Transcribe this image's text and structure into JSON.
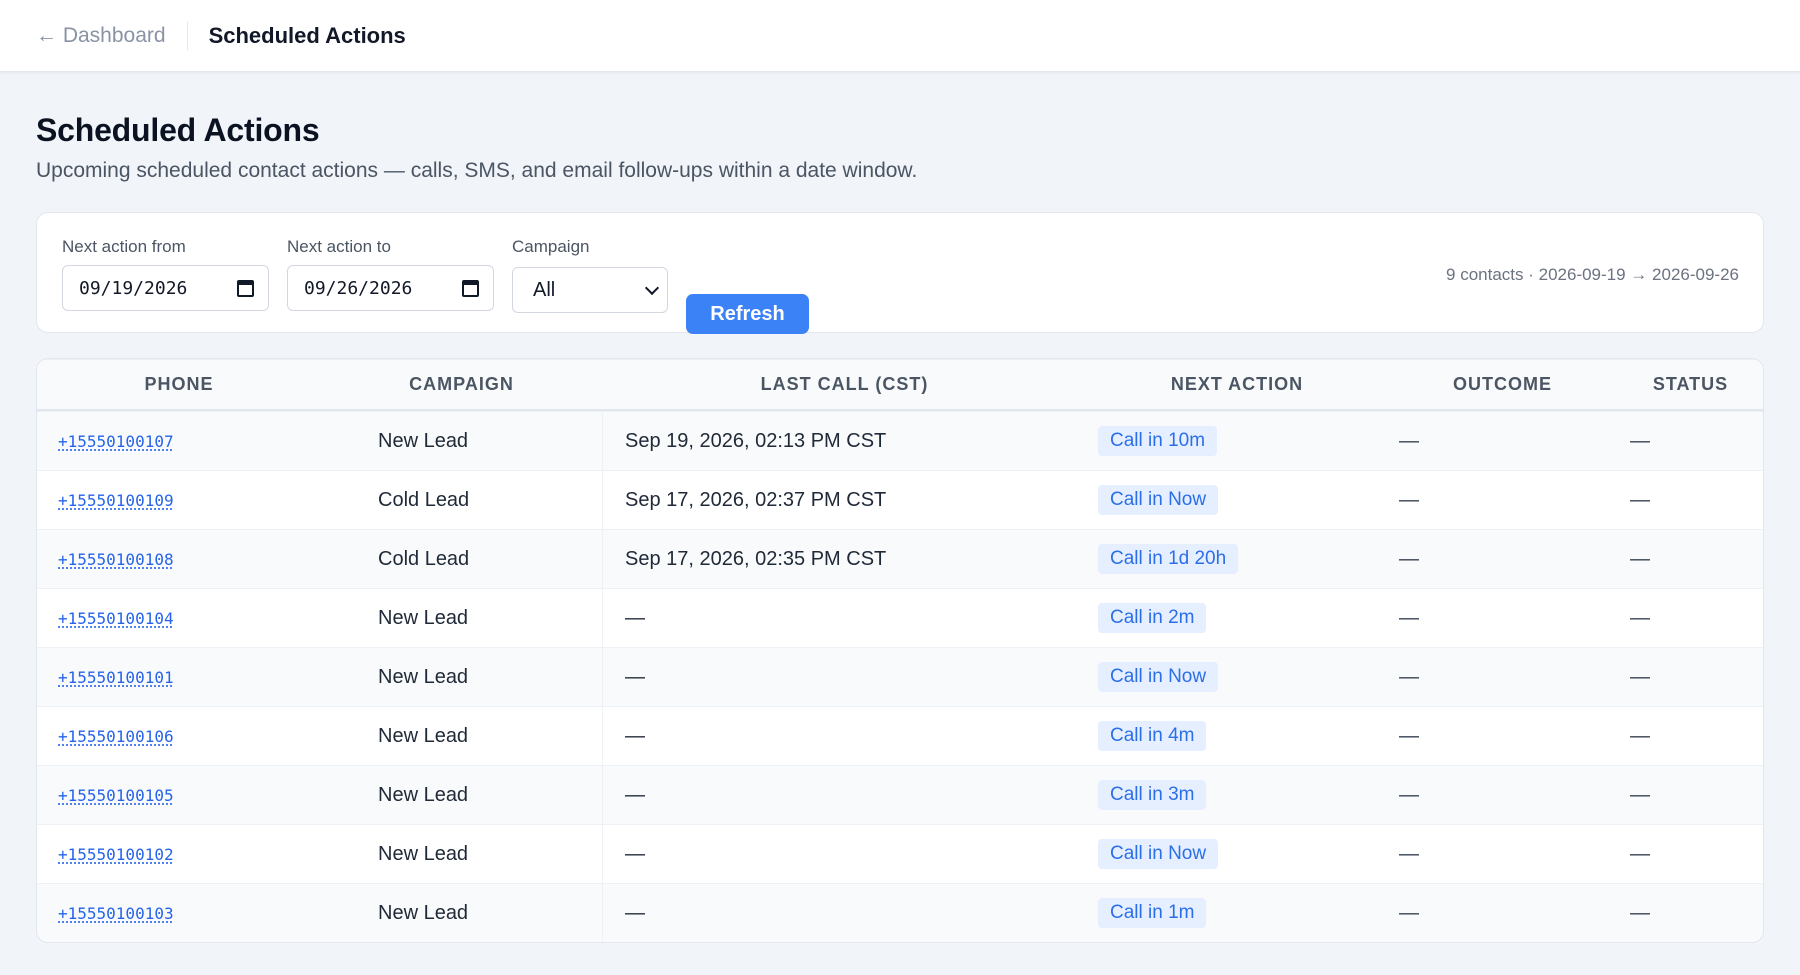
{
  "topbar": {
    "back_label": "← Dashboard",
    "title": "Scheduled Actions"
  },
  "page": {
    "title": "Scheduled Actions",
    "subtitle": "Upcoming scheduled contact actions — calls, SMS, and email follow-ups within a date window."
  },
  "filters": {
    "from_label": "Next action from",
    "from_value": "09/19/2026",
    "to_label": "Next action to",
    "to_value": "09/26/2026",
    "campaign_label": "Campaign",
    "campaign_value": "All",
    "refresh_label": "Refresh",
    "summary": "9 contacts · 2026-09-19 → 2026-09-26"
  },
  "table": {
    "columns": [
      "PHONE",
      "CAMPAIGN",
      "LAST CALL (CST)",
      "NEXT ACTION",
      "OUTCOME",
      "STATUS"
    ],
    "rows": [
      {
        "phone": "+15550100107",
        "campaign": "New Lead",
        "last_call": "Sep 19, 2026, 02:13 PM CST",
        "next_action": "Call in 10m",
        "outcome": "—",
        "status": "—"
      },
      {
        "phone": "+15550100109",
        "campaign": "Cold Lead",
        "last_call": "Sep 17, 2026, 02:37 PM CST",
        "next_action": "Call in Now",
        "outcome": "—",
        "status": "—"
      },
      {
        "phone": "+15550100108",
        "campaign": "Cold Lead",
        "last_call": "Sep 17, 2026, 02:35 PM CST",
        "next_action": "Call in 1d 20h",
        "outcome": "—",
        "status": "—"
      },
      {
        "phone": "+15550100104",
        "campaign": "New Lead",
        "last_call": "—",
        "next_action": "Call in 2m",
        "outcome": "—",
        "status": "—"
      },
      {
        "phone": "+15550100101",
        "campaign": "New Lead",
        "last_call": "—",
        "next_action": "Call in Now",
        "outcome": "—",
        "status": "—"
      },
      {
        "phone": "+15550100106",
        "campaign": "New Lead",
        "last_call": "—",
        "next_action": "Call in 4m",
        "outcome": "—",
        "status": "—"
      },
      {
        "phone": "+15550100105",
        "campaign": "New Lead",
        "last_call": "—",
        "next_action": "Call in 3m",
        "outcome": "—",
        "status": "—"
      },
      {
        "phone": "+15550100102",
        "campaign": "New Lead",
        "last_call": "—",
        "next_action": "Call in Now",
        "outcome": "—",
        "status": "—"
      },
      {
        "phone": "+15550100103",
        "campaign": "New Lead",
        "last_call": "—",
        "next_action": "Call in 1m",
        "outcome": "—",
        "status": "—"
      }
    ]
  },
  "colors": {
    "accent": "#3b82f6",
    "badge_bg": "#e6efff",
    "badge_text": "#2b6fe8",
    "link": "#2563eb",
    "background": "#f1f4f9"
  },
  "icons": {
    "date_picker": "calendar-icon",
    "select": "chevron-down-icon"
  }
}
